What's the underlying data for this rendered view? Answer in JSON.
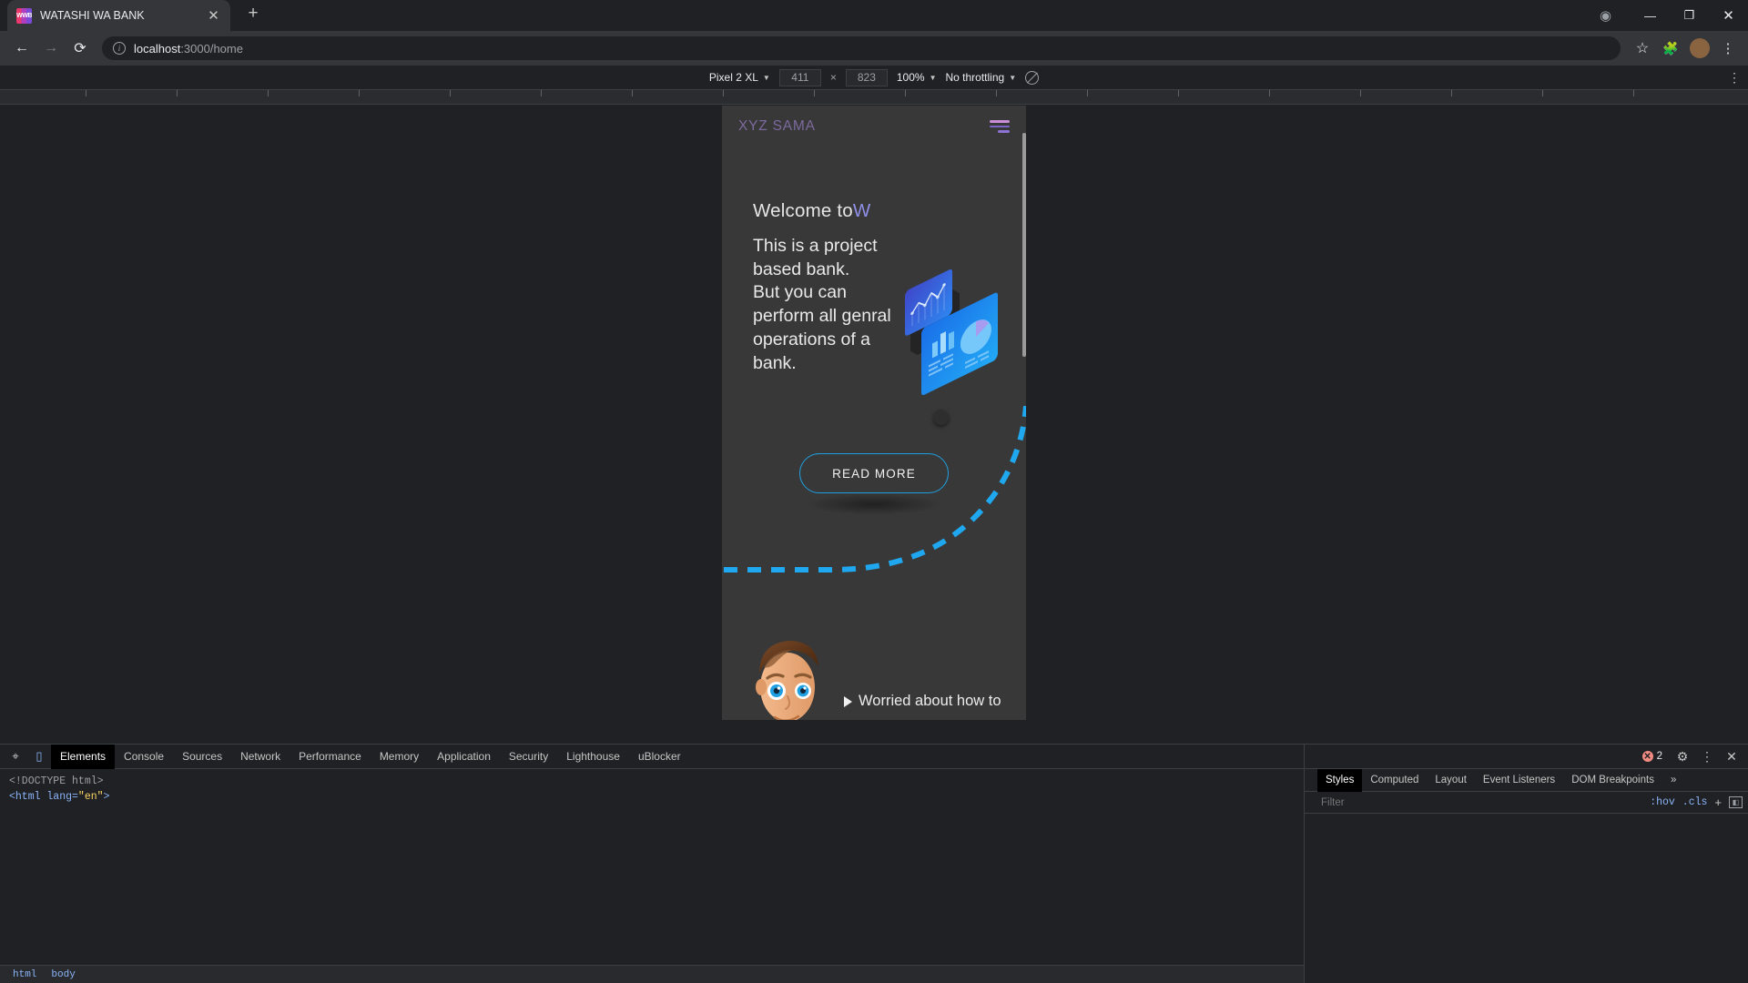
{
  "browser": {
    "tab": {
      "title": "WATASHI WA BANK",
      "favicon_label": "WWB",
      "close_icon": "close-icon",
      "new_tab_icon": "plus-icon"
    },
    "window_controls": {
      "record": "record-icon",
      "minimize": "minimize-icon",
      "maximize": "maximize-icon",
      "close": "close-icon"
    },
    "nav": {
      "back": "back-arrow-icon",
      "forward": "forward-arrow-icon",
      "reload": "reload-icon"
    },
    "omnibox": {
      "host": "localhost",
      "path": ":3000/home",
      "info_icon": "info-icon",
      "star_icon": "star-icon"
    },
    "toolbar_icons": {
      "extensions": "puzzle-icon",
      "profile": "avatar-icon",
      "menu": "kebab-menu-icon"
    }
  },
  "device_toolbar": {
    "device": "Pixel 2 XL",
    "width": "411",
    "height": "823",
    "separator": "×",
    "zoom": "100%",
    "throttling": "No throttling",
    "network_icon": "no-throttle-icon",
    "more_icon": "kebab-menu-icon"
  },
  "page": {
    "brand": "XYZ SAMA",
    "hero_title_text": "Welcome to",
    "hero_title_accent": "W",
    "hero_body": "This is a project\nbased bank.\nBut you can\nperform all genral\noperations of a\nbank.",
    "read_more": "READ MORE",
    "bottom_text": "Worried about how to",
    "illustration": "isometric-dashboard-card",
    "character": "cartoon-man-avatar"
  },
  "devtools": {
    "tabs": [
      "Elements",
      "Console",
      "Sources",
      "Network",
      "Performance",
      "Memory",
      "Application",
      "Security",
      "Lighthouse",
      "uBlocker"
    ],
    "selected_tab": "Elements",
    "inspect_icon": "inspect-cursor-icon",
    "device_icon": "device-toggle-icon",
    "dom": {
      "doctype": "<!DOCTYPE html>",
      "html_open": "<html lang=",
      "lang_value": "\"en\"",
      "html_close": ">"
    },
    "breadcrumb": [
      "html",
      "body"
    ],
    "error_count": "2",
    "error_icon": "error-icon",
    "settings_icon": "gear-icon",
    "more_icon": "kebab-menu-icon",
    "close_icon": "close-icon",
    "styles_tabs": [
      "Styles",
      "Computed",
      "Layout",
      "Event Listeners",
      "DOM Breakpoints"
    ],
    "styles_selected": "Styles",
    "styles_overflow": "»",
    "filter_placeholder": "Filter",
    "hov_label": ":hov",
    "cls_label": ".cls",
    "plus_icon": "plus-icon",
    "sidebar_icon": "panel-toggle-icon"
  },
  "colors": {
    "accent_blue": "#1f9fe0",
    "brand_purple": "#7c6a9e",
    "title_accent": "#8f8fe8",
    "page_bg": "#383838"
  }
}
